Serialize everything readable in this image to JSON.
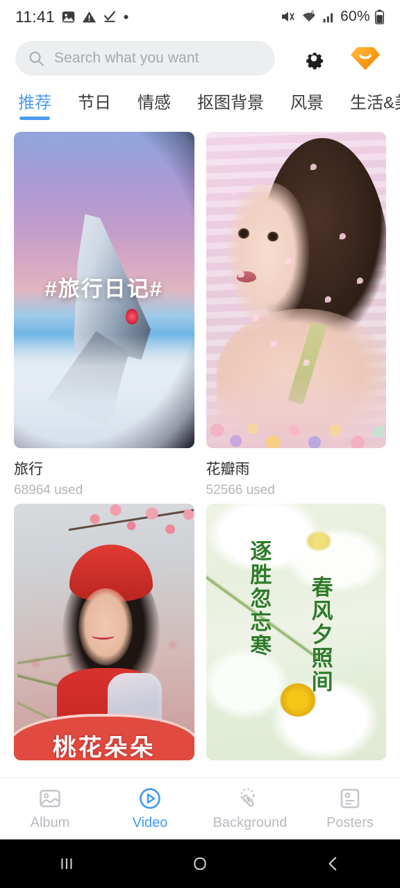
{
  "status_bar": {
    "time": "11:41",
    "battery_percent": "60%",
    "icons": [
      "image-icon",
      "warning-triangle-icon",
      "check-underline-icon",
      "dot-icon",
      "mute-icon",
      "wifi-icon",
      "signal-bars-icon",
      "battery-icon"
    ]
  },
  "search": {
    "placeholder": "Search what you want",
    "value": "",
    "search_icon": "search-icon",
    "settings_icon": "gear-icon",
    "vip_icon": "vip-diamond-icon"
  },
  "tabs": [
    {
      "label": "推荐",
      "active": true
    },
    {
      "label": "节日",
      "active": false
    },
    {
      "label": "情感",
      "active": false
    },
    {
      "label": "抠图背景",
      "active": false
    },
    {
      "label": "风景",
      "active": false
    },
    {
      "label": "生活&美",
      "active": false
    }
  ],
  "cards": [
    {
      "title": "旅行",
      "usage": "68964 used",
      "overlay_text": "#旅行日记#",
      "image_description": "airplane-wing-sunset"
    },
    {
      "title": "花瓣雨",
      "usage": "52566 used",
      "overlay_text": "",
      "image_description": "woman-petal-rain-flowers"
    },
    {
      "title": "",
      "usage": "",
      "overlay_text": "桃花朵朵",
      "image_description": "woman-red-beret-peach-blossom"
    },
    {
      "title": "",
      "usage": "",
      "overlay_text_1": "逐胜忽忘寒",
      "overlay_text_2": "春风夕照间",
      "image_description": "white-daisies-green-poem"
    }
  ],
  "bottom_nav": [
    {
      "label": "Album",
      "icon": "photo-icon",
      "active": false
    },
    {
      "label": "Video",
      "icon": "play-circle-icon",
      "active": true
    },
    {
      "label": "Background",
      "icon": "magic-wand-icon",
      "active": false
    },
    {
      "label": "Posters",
      "icon": "id-card-icon",
      "active": false
    }
  ],
  "android_nav": {
    "recents": "recents-icon",
    "home": "home-icon",
    "back": "back-icon"
  },
  "colors": {
    "accent_blue": "#4b9cf2",
    "vip_orange": "#f7a11b",
    "search_bg": "#eceef0",
    "inactive_gray": "#b7bac0"
  }
}
